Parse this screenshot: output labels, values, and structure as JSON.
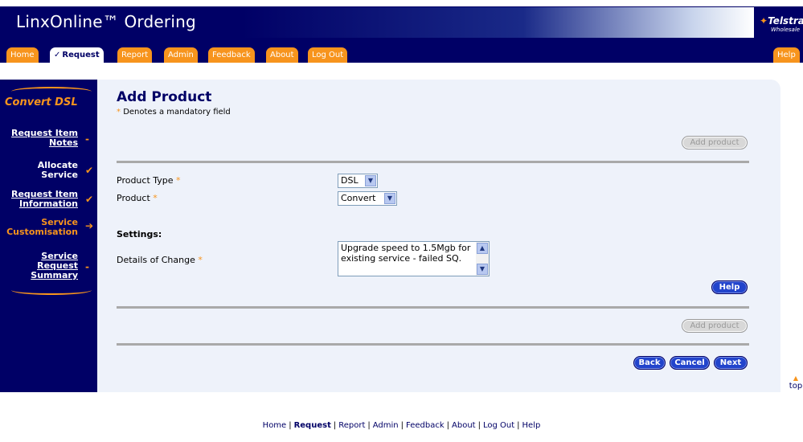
{
  "app": {
    "title": "LinxOnline™ Ordering",
    "logo_text": "Telstra",
    "logo_subtext": "Wholesale"
  },
  "nav": {
    "tabs": [
      {
        "label": "Home"
      },
      {
        "label": "Request",
        "active": true,
        "tick": "✓"
      },
      {
        "label": "Report"
      },
      {
        "label": "Admin"
      },
      {
        "label": "Feedback"
      },
      {
        "label": "About"
      },
      {
        "label": "Log Out"
      }
    ],
    "help": "Help"
  },
  "sidebar": {
    "title": "Convert DSL",
    "items": [
      {
        "line1": "Request Item",
        "line2": "Notes",
        "mark": "-"
      },
      {
        "line1": "Allocate",
        "line2": "Service",
        "mark": "✔"
      },
      {
        "line1": "Request Item",
        "line2": "Information",
        "mark": "✔"
      },
      {
        "line1": "Service",
        "line2": "Customisation",
        "mark": "➔"
      },
      {
        "line1": "Service",
        "line2": "Request",
        "line3": "Summary",
        "mark": "-"
      }
    ]
  },
  "main": {
    "title": "Add Product",
    "mandatory_note": "Denotes a mandatory field",
    "star": "*",
    "add_product_label": "Add product",
    "product_type": {
      "label": "Product Type",
      "value": "DSL"
    },
    "product": {
      "label": "Product",
      "value": "Convert"
    },
    "settings_label": "Settings:",
    "details": {
      "label": "Details of Change",
      "value": "Upgrade speed to 1.5Mgb for existing service - failed SQ."
    },
    "help_label": "Help",
    "back_label": "Back",
    "cancel_label": "Cancel",
    "next_label": "Next"
  },
  "top_link": "top",
  "footer": {
    "links": [
      "Home",
      "Request",
      "Report",
      "Admin",
      "Feedback",
      "About",
      "Log Out",
      "Help"
    ],
    "current": "Request"
  },
  "colors": {
    "brand_navy": "#000066",
    "accent_orange": "#f7941d",
    "panel_bg": "#eef2fa",
    "button_blue": "#2244cc"
  }
}
